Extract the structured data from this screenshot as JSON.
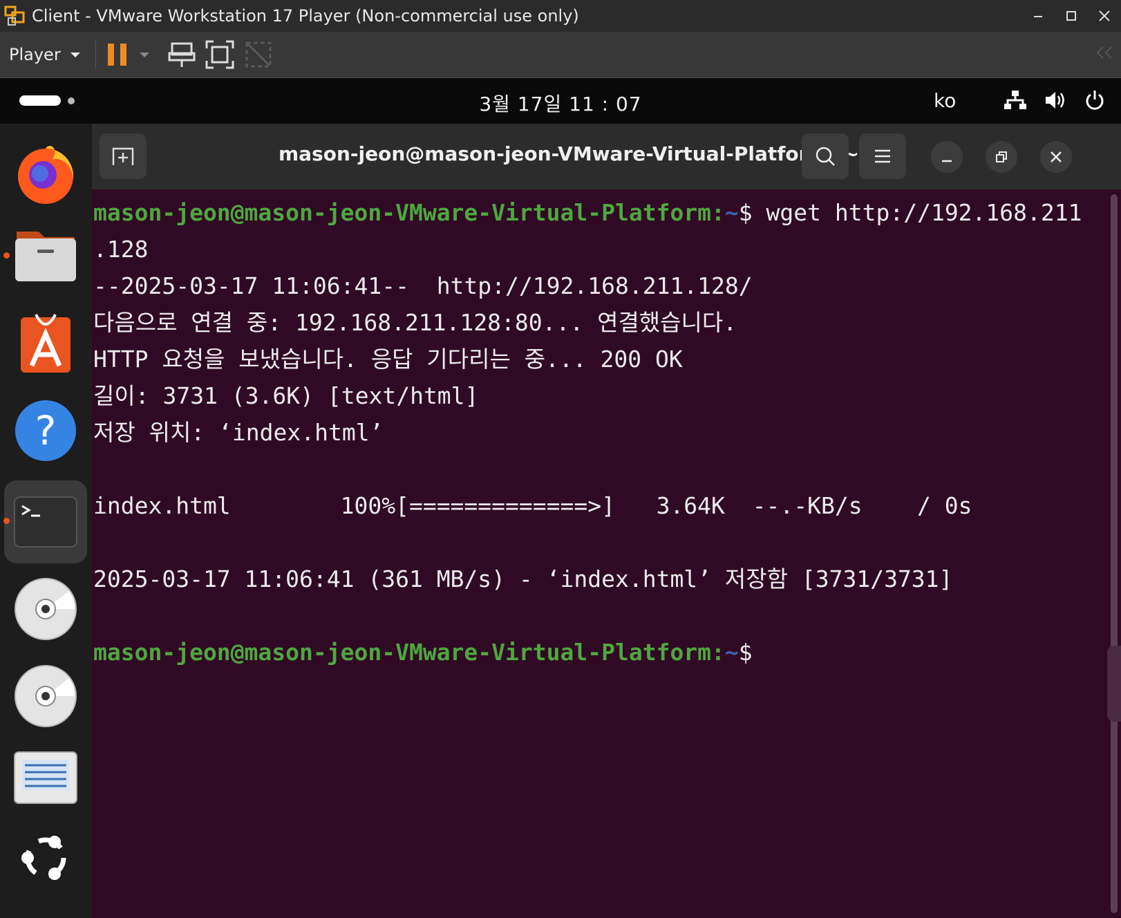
{
  "vmware": {
    "title": "Client - VMware Workstation 17 Player (Non-commercial use only)",
    "player_menu_label": "Player",
    "icons": [
      "vmware-logo-icon",
      "pause-icon",
      "send-ctrl-alt-del-icon",
      "fullscreen-icon",
      "unity-icon",
      "collapse-icon"
    ]
  },
  "gnome": {
    "clock": "3월 17일  11 : 07",
    "keyboard_layout": "ko",
    "tray_icons": [
      "network-icon",
      "volume-icon",
      "power-icon"
    ]
  },
  "dock": {
    "items": [
      "firefox",
      "files",
      "app-center",
      "help",
      "terminal",
      "disc-1",
      "disc-2",
      "text-editor",
      "ubuntu-logo"
    ]
  },
  "terminal": {
    "title": "mason-jeon@mason-jeon-VMware-Virtual-Platform: ~",
    "prompt_user_host": "mason-jeon@mason-jeon-VMware-Virtual-Platform:",
    "prompt_path": "~",
    "prompt_symbol": "$",
    "command": " wget http://192.168.211",
    "command_wrap": ".128",
    "out1": "--2025-03-17 11:06:41--  http://192.168.211.128/",
    "out2": "다음으로 연결 중: 192.168.211.128:80... 연결했습니다.",
    "out3": "HTTP 요청을 보냈습니다. 응답 기다리는 중... 200 OK",
    "out4": "길이: 3731 (3.6K) [text/html]",
    "out5": "저장 위치: ‘index.html’",
    "out6": "",
    "out7": "index.html        100%[=============>]   3.64K  --.-KB/s    / 0s",
    "out8": "",
    "out9": "2025-03-17 11:06:41 (361 MB/s) - ‘index.html’ 저장함 [3731/3731]",
    "out10": ""
  },
  "colors": {
    "terminal_bg": "#300a24",
    "prompt_green": "#4ea73f",
    "path_blue": "#3565b0",
    "running_indicator": "#e95420",
    "pause_orange": "#f08a24"
  }
}
